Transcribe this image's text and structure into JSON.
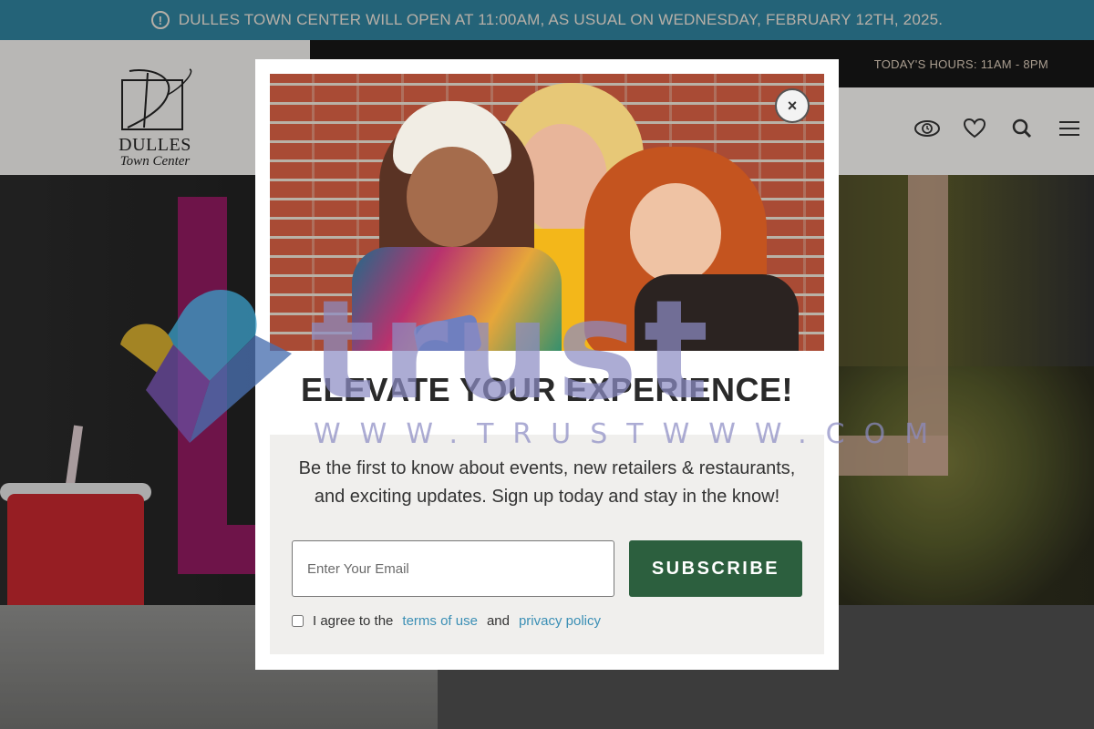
{
  "alert": {
    "icon": "alert-circle-icon",
    "text": "DULLES TOWN CENTER WILL OPEN AT 11:00AM, AS USUAL ON WEDNESDAY, FEBRUARY 12TH, 2025."
  },
  "header": {
    "logo_monogram": "D",
    "logo_name": "DULLES",
    "logo_sub": "Town Center",
    "hours": "TODAY'S HOURS: 11AM - 8PM",
    "icons": [
      "accessibility-eye-icon",
      "heart-icon",
      "search-icon",
      "hamburger-menu-icon"
    ]
  },
  "modal": {
    "close_label": "×",
    "title": "ELEVATE YOUR EXPERIENCE!",
    "description": "Be the first to know about events, new retailers & restaurants, and exciting updates. Sign up today and stay in the know!",
    "email_placeholder": "Enter Your Email",
    "email_value": "",
    "subscribe_label": "SUBSCRIBE",
    "agree_prefix": "I agree to the",
    "terms_link": "terms of use",
    "agree_and": "and",
    "privacy_link": "privacy policy",
    "agree_checked": false
  },
  "watermark": {
    "brand": "trust",
    "url": "WWW.TRUSTWWW.COM"
  },
  "colors": {
    "alert_bg": "#2f7f9a",
    "subscribe_bg": "#2c5f3e",
    "link": "#3b8fb5",
    "hours_bg": "#161616"
  }
}
